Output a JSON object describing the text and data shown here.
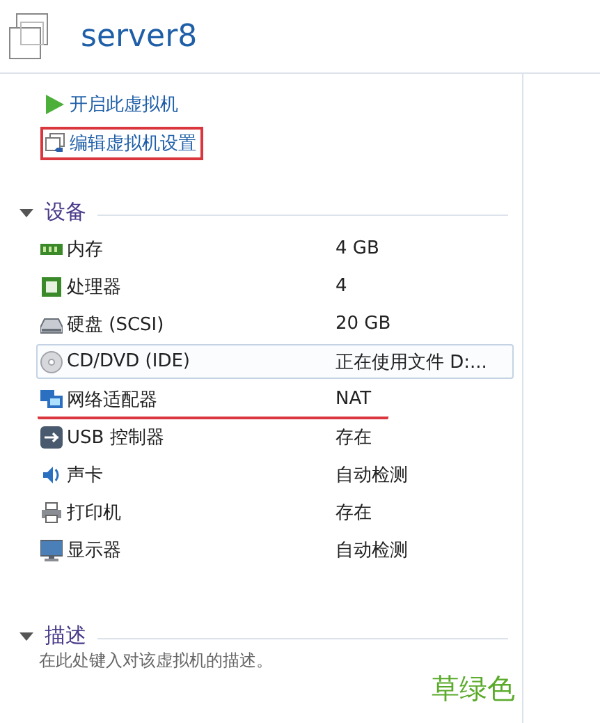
{
  "header": {
    "title": "server8"
  },
  "actions": [
    {
      "kind": "play",
      "label": "开启此虚拟机",
      "annotated": false
    },
    {
      "kind": "settings",
      "label": "编辑虚拟机设置",
      "annotated": true
    }
  ],
  "devices_section": {
    "title": "设备",
    "expanded": true,
    "devices": [
      {
        "kind": "memory",
        "name": "内存",
        "value": "4 GB",
        "selected": false,
        "underlined": false
      },
      {
        "kind": "cpu",
        "name": "处理器",
        "value": "4",
        "selected": false,
        "underlined": false
      },
      {
        "kind": "disk",
        "name": "硬盘 (SCSI)",
        "value": "20 GB",
        "selected": false,
        "underlined": false
      },
      {
        "kind": "cd",
        "name": "CD/DVD (IDE)",
        "value": "正在使用文件 D:...",
        "selected": true,
        "underlined": false
      },
      {
        "kind": "network",
        "name": "网络适配器",
        "value": "NAT",
        "selected": false,
        "underlined": true
      },
      {
        "kind": "usb",
        "name": "USB 控制器",
        "value": "存在",
        "selected": false,
        "underlined": false
      },
      {
        "kind": "sound",
        "name": "声卡",
        "value": "自动检测",
        "selected": false,
        "underlined": false
      },
      {
        "kind": "printer",
        "name": "打印机",
        "value": "存在",
        "selected": false,
        "underlined": false
      },
      {
        "kind": "display",
        "name": "显示器",
        "value": "自动检测",
        "selected": false,
        "underlined": false
      }
    ]
  },
  "description_section": {
    "title": "描述",
    "expanded": true,
    "placeholder": "在此处键入对该虚拟机的描述。"
  },
  "annotation": {
    "text": "草绿色"
  }
}
